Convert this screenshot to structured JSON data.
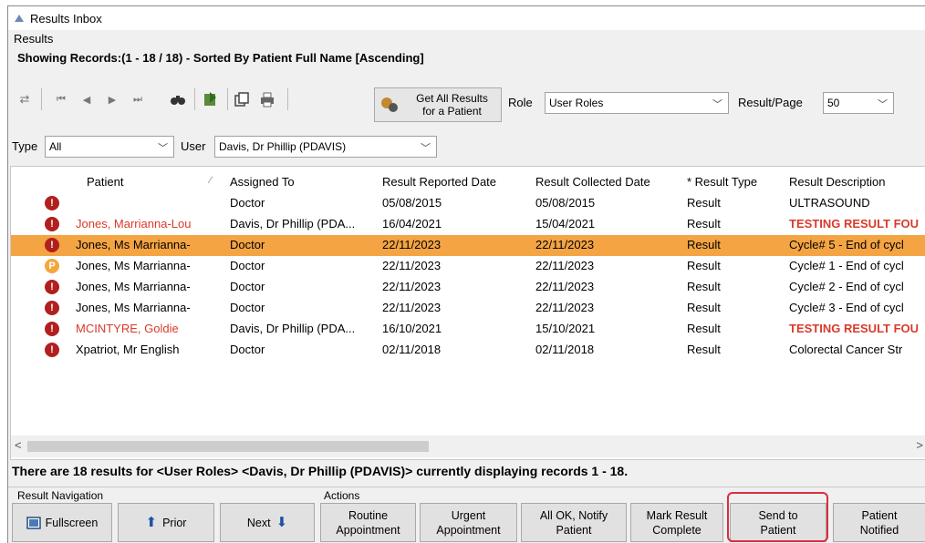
{
  "window": {
    "title": "Results Inbox"
  },
  "group_label": "Results",
  "showing_text": "Showing Records:(1 - 18 / 18) - Sorted By Patient Full Name [Ascending]",
  "toolbar": {
    "get_all_label": "Get All Results\nfor a Patient",
    "role_label": "Role",
    "role_value": "User Roles",
    "result_page_label": "Result/Page",
    "result_page_value": "50"
  },
  "filters": {
    "type_label": "Type",
    "type_value": "All",
    "user_label": "User",
    "user_value": "Davis, Dr Phillip (PDAVIS)"
  },
  "columns": [
    "Patient",
    "Assigned To",
    "Result Reported Date",
    "Result Collected Date",
    "* Result Type",
    "Result Description"
  ],
  "rows": [
    {
      "badge": "!",
      "badge_type": "o",
      "patient": "",
      "patient_style": "normal",
      "assigned": "Doctor",
      "reported": "05/08/2015",
      "collected": "05/08/2015",
      "type": "Result",
      "desc": "ULTRASOUND",
      "desc_style": "normal",
      "selected": false
    },
    {
      "badge": "!",
      "badge_type": "o",
      "patient": "Jones, Marrianna-Lou",
      "patient_style": "red",
      "assigned": "Davis, Dr Phillip (PDA...",
      "reported": "16/04/2021",
      "collected": "15/04/2021",
      "type": "Result",
      "desc": "TESTING RESULT FOU",
      "desc_style": "red",
      "selected": false
    },
    {
      "badge": "!",
      "badge_type": "o",
      "patient": "Jones, Ms Marrianna-",
      "patient_style": "normal",
      "assigned": "Doctor",
      "reported": "22/11/2023",
      "collected": "22/11/2023",
      "type": "Result",
      "desc": "Cycle# 5 - End of cycl",
      "desc_style": "normal",
      "selected": true
    },
    {
      "badge": "P",
      "badge_type": "p",
      "patient": "Jones, Ms Marrianna-",
      "patient_style": "normal",
      "assigned": "Doctor",
      "reported": "22/11/2023",
      "collected": "22/11/2023",
      "type": "Result",
      "desc": "Cycle# 1 - End of cycl",
      "desc_style": "normal",
      "selected": false
    },
    {
      "badge": "!",
      "badge_type": "o",
      "patient": "Jones, Ms Marrianna-",
      "patient_style": "normal",
      "assigned": "Doctor",
      "reported": "22/11/2023",
      "collected": "22/11/2023",
      "type": "Result",
      "desc": "Cycle# 2 - End of cycl",
      "desc_style": "normal",
      "selected": false
    },
    {
      "badge": "!",
      "badge_type": "o",
      "patient": "Jones, Ms Marrianna-",
      "patient_style": "normal",
      "assigned": "Doctor",
      "reported": "22/11/2023",
      "collected": "22/11/2023",
      "type": "Result",
      "desc": "Cycle# 3 - End of cycl",
      "desc_style": "normal",
      "selected": false
    },
    {
      "badge": "!",
      "badge_type": "o",
      "patient": "MCINTYRE, Goldie",
      "patient_style": "red",
      "assigned": "Davis, Dr Phillip (PDA...",
      "reported": "16/10/2021",
      "collected": "15/10/2021",
      "type": "Result",
      "desc": "TESTING RESULT FOU",
      "desc_style": "red",
      "selected": false
    },
    {
      "badge": "!",
      "badge_type": "o",
      "patient": "Xpatriot, Mr English",
      "patient_style": "normal",
      "assigned": "Doctor",
      "reported": "02/11/2018",
      "collected": "02/11/2018",
      "type": "Result",
      "desc": "Colorectal Cancer Str",
      "desc_style": "normal",
      "selected": false
    }
  ],
  "summary": "There are 18 results for <User Roles> <Davis, Dr Phillip (PDAVIS)> currently displaying records 1 - 18.",
  "sections": {
    "navigation": "Result Navigation",
    "actions": "Actions"
  },
  "nav_buttons": {
    "fullscreen": "Fullscreen",
    "prior": "Prior",
    "next": "Next"
  },
  "action_buttons": [
    "Routine\nAppointment",
    "Urgent\nAppointment",
    "All OK, Notify\nPatient",
    "Mark Result\nComplete",
    "Send to\nPatient",
    "Patient\nNotified"
  ],
  "colors": {
    "selected_row": "#f4a443",
    "alert_red": "#d93a2a",
    "badge_red": "#b11f1f",
    "badge_pending": "#f2a73b",
    "highlight_box": "#d83040"
  },
  "icons": [
    "refresh-icon",
    "first-icon",
    "prev-icon",
    "play-icon",
    "last-icon",
    "binoculars-icon",
    "export-icon",
    "copy-icon",
    "print-icon"
  ]
}
